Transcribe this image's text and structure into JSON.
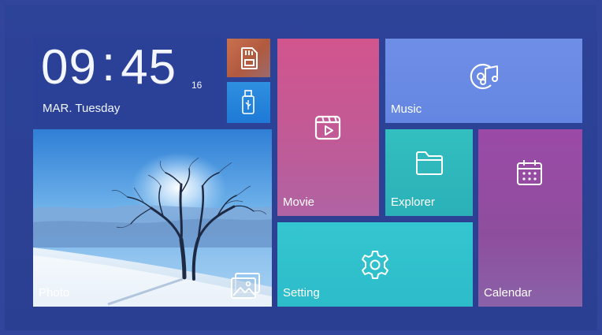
{
  "clock": {
    "hours": "09",
    "separator": ":",
    "minutes": "45",
    "seconds": "16"
  },
  "date": {
    "text": "MAR.  Tuesday"
  },
  "tiles": {
    "sd_card": {
      "icon": "sd-card-icon"
    },
    "usb": {
      "icon": "usb-drive-icon"
    },
    "movie": {
      "label": "Movie",
      "icon": "video-player-icon"
    },
    "music": {
      "label": "Music",
      "icon": "music-disc-icon"
    },
    "explorer": {
      "label": "Explorer",
      "icon": "folder-icon"
    },
    "calendar": {
      "label": "Calendar",
      "icon": "calendar-icon"
    },
    "setting": {
      "label": "Setting",
      "icon": "gear-icon"
    },
    "photo": {
      "label": "Photo",
      "icon": "gallery-icon"
    }
  },
  "colors": {
    "background": "#2b3f92",
    "movie": "#c65891",
    "music": "#6a8ae4",
    "explorer": "#30b8bc",
    "calendar": "#934ea2",
    "setting": "#30c1cd",
    "sd_card": "#b9624a",
    "usb": "#2786dc"
  }
}
